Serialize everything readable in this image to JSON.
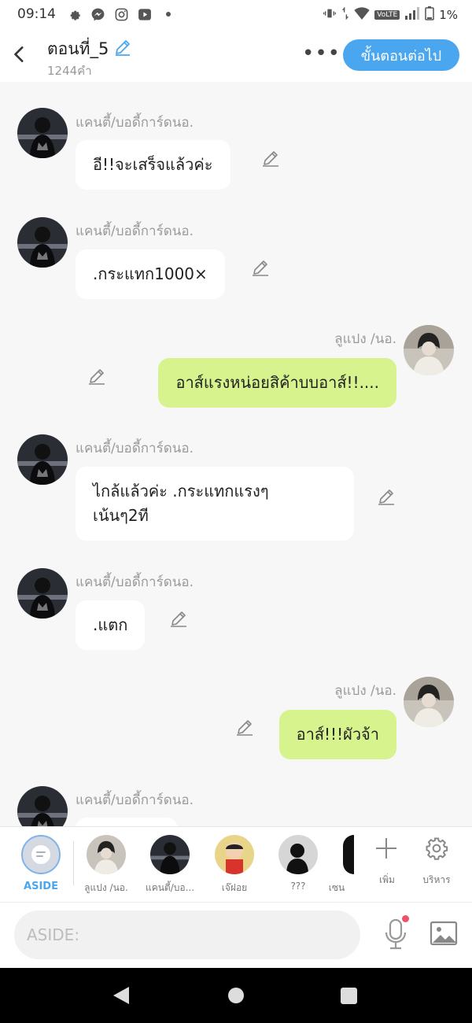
{
  "status_bar": {
    "time": "09:14",
    "volte": "VoLTE",
    "battery": "1%"
  },
  "header": {
    "title": "ตอนที่_5",
    "word_count": "1244คำ",
    "more": "•••",
    "next_button": "ขั้นตอนต่อไป"
  },
  "colors": {
    "accent": "#4aa6ee",
    "my_bubble": "#d7f38e",
    "other_bubble": "#ffffff"
  },
  "messages": [
    {
      "speaker": "แคนตี้/บอดี้การ์ดนอ.",
      "text": "อี!!จะเสร็จแล้วค่ะ",
      "side": "left",
      "avatar": "avatar-dark"
    },
    {
      "speaker": "แคนตี้/บอดี้การ์ดนอ.",
      "text": ".กระแทก1000×",
      "side": "left",
      "avatar": "avatar-dark"
    },
    {
      "speaker": "ลูแปง /นอ.",
      "text": "อาส์แรงหน่อยสิค้าบบอาส์!!....",
      "side": "right",
      "avatar": "avatar-light"
    },
    {
      "speaker": "แคนตี้/บอดี้การ์ดนอ.",
      "text_lines": [
        "ไกล้แล้วค่ะ .กระแทกแรงๆ",
        "เน้นๆ2ที"
      ],
      "side": "left",
      "avatar": "avatar-dark"
    },
    {
      "speaker": "แคนตี้/บอดี้การ์ดนอ.",
      "text": ".แตก",
      "side": "left",
      "avatar": "avatar-dark"
    },
    {
      "speaker": "ลูแปง /นอ.",
      "text": "อาส์!!!ผัวจ้า",
      "side": "right",
      "avatar": "avatar-light"
    },
    {
      "speaker": "แคนตี้/บอดี้การ์ดนอ.",
      "text": "",
      "side": "left",
      "avatar": "avatar-dark"
    }
  ],
  "characters": {
    "aside_label": "ASIDE",
    "items": [
      {
        "label": "ลูแปง /นอ.",
        "avatar": "avatar-light"
      },
      {
        "label": "แคนตี้/บอ...",
        "avatar": "avatar-dark"
      },
      {
        "label": "เจ๊ฝอย",
        "avatar": "cartoon-boy"
      },
      {
        "label": "???",
        "avatar": "silhouette"
      },
      {
        "label": "เซน",
        "avatar": "avatar-dark"
      }
    ],
    "add_label": "เพิ่ม",
    "manage_label": "บริหาร"
  },
  "input": {
    "placeholder": "ASIDE:"
  },
  "icons": [
    "settings-icon",
    "messenger-icon",
    "instagram-icon",
    "video-icon",
    "back-arrow-icon",
    "edit-pencil-icon",
    "mic-icon",
    "image-icon",
    "plus-icon",
    "gear-icon"
  ]
}
